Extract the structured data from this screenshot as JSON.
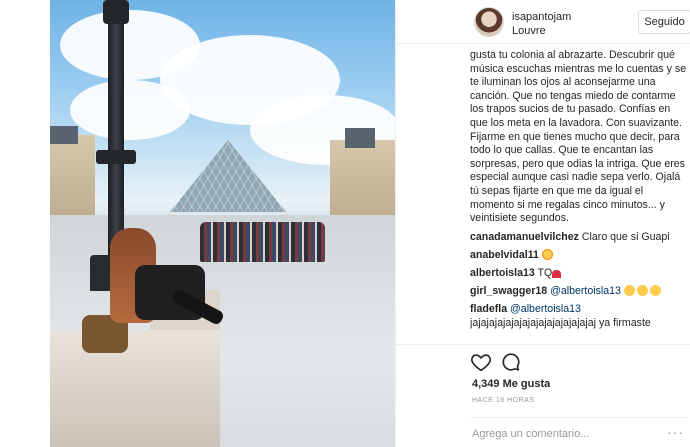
{
  "header": {
    "username": "isapantojam",
    "location": "Louvre",
    "follow_label": "Seguido"
  },
  "caption": {
    "text": "gusta tu colonia al abrazarte. Descubrir qué música escuchas mientras me lo cuentas y se te iluminan los ojos al aconsejarme una canción. Que no tengas miedo de contarme los trapos sucios de tu pasado. Confías en que los meta en la lavadora. Con suavizante. Fijarme en que tienes mucho que decir, para todo lo que callas. Que te encantan las sorpresas, pero que odias la intriga. Que eres especial aunque casi nadie sepa verlo. Ojalá tú sepas fijarte en que me da igual el momento si me regalas cinco minutos... y veintisiete segundos."
  },
  "comments": [
    {
      "user": "canadamanuelvilchez",
      "text": "Claro que si Guapi"
    },
    {
      "user": "anabelvidal11",
      "emoji": "smiling-face-with-heart-eyes"
    },
    {
      "user": "albertoisla13",
      "text": "TQ",
      "emoji": "red-heart"
    },
    {
      "user": "girl_swagger18",
      "mention": "@albertoisla13",
      "emoji": "sad-faces"
    },
    {
      "user": "fladefla",
      "mention": "@albertoisla13",
      "text": "jajajajajajajajajajajajajajajaj ya firmaste"
    }
  ],
  "actions": {
    "likes": "4,349 Me gusta",
    "time_ago": "HACE 18 HORAS",
    "like_icon": "heart-outline-icon",
    "comment_icon": "speech-bubble-icon"
  },
  "composer": {
    "placeholder": "Agrega un comentario...",
    "more_label": "···"
  },
  "colors": {
    "text": "#262626",
    "secondary": "#999999",
    "mention": "#003569",
    "border": "#efefef"
  }
}
